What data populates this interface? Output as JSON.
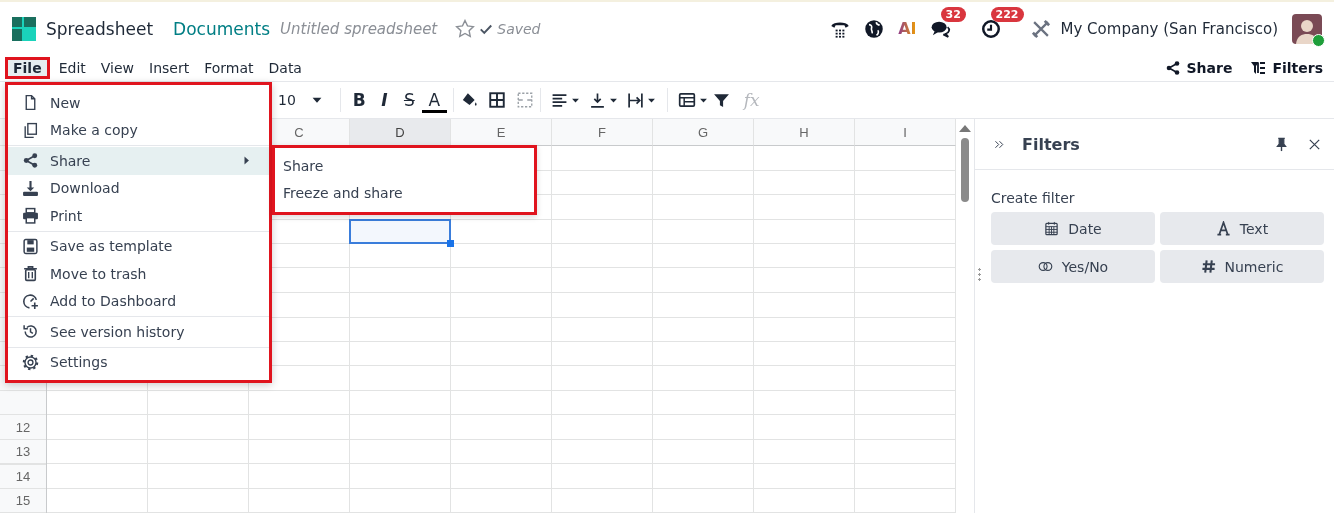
{
  "app": {
    "name": "Spreadsheet"
  },
  "breadcrumb": {
    "parent": "Documents",
    "title": "Untitled spreadsheet",
    "favorite": false,
    "status": "Saved"
  },
  "systray": [
    {
      "kind": "phone"
    },
    {
      "kind": "globe"
    },
    {
      "kind": "ai",
      "label": "AI"
    },
    {
      "kind": "chat",
      "badge": "32"
    },
    {
      "kind": "activity",
      "badge": "222"
    },
    {
      "kind": "tools"
    }
  ],
  "company": "My Company (San Francisco)",
  "user": {
    "online": true
  },
  "menubar": [
    {
      "label": "File",
      "selected": true
    },
    {
      "label": "Edit",
      "selected": false
    },
    {
      "label": "View",
      "selected": false
    },
    {
      "label": "Insert",
      "selected": false
    },
    {
      "label": "Format",
      "selected": false
    },
    {
      "label": "Data",
      "selected": false
    }
  ],
  "actions": [
    {
      "kind": "share",
      "label": "Share"
    },
    {
      "kind": "filters",
      "label": "Filters"
    }
  ],
  "toolbar": {
    "font_size": "10",
    "format": [
      {
        "kind": "bold",
        "label": "B"
      },
      {
        "kind": "italic",
        "label": "I"
      },
      {
        "kind": "strike",
        "label": "S"
      },
      {
        "kind": "color",
        "label": "A"
      }
    ],
    "formula_icon": "fx"
  },
  "grid": {
    "columns": [
      {
        "label": "C",
        "selected": false
      },
      {
        "label": "D",
        "selected": true
      },
      {
        "label": "E",
        "selected": false
      },
      {
        "label": "F",
        "selected": false
      },
      {
        "label": "G",
        "selected": false
      },
      {
        "label": "H",
        "selected": false
      },
      {
        "label": "I",
        "selected": false
      }
    ],
    "rows": [
      "12",
      "13",
      "14",
      "15"
    ]
  },
  "file_menu": [
    [
      {
        "kind": "new",
        "label": "New",
        "selected": false
      },
      {
        "kind": "copy",
        "label": "Make a copy",
        "selected": false
      }
    ],
    [
      {
        "kind": "share",
        "label": "Share",
        "selected": true,
        "submenu": true
      },
      {
        "kind": "download",
        "label": "Download",
        "selected": false
      },
      {
        "kind": "print",
        "label": "Print",
        "selected": false
      }
    ],
    [
      {
        "kind": "save",
        "label": "Save as template",
        "selected": false
      },
      {
        "kind": "trash",
        "label": "Move to trash",
        "selected": false
      },
      {
        "kind": "dashboard",
        "label": "Add to Dashboard",
        "selected": false
      }
    ],
    [
      {
        "kind": "history",
        "label": "See version history",
        "selected": false
      }
    ],
    [
      {
        "kind": "settings",
        "label": "Settings",
        "selected": false
      }
    ]
  ],
  "share_submenu": [
    "Share",
    "Freeze and share"
  ],
  "filters_panel": {
    "title": "Filters",
    "section": "Create filter",
    "types": [
      {
        "kind": "date",
        "label": "Date"
      },
      {
        "kind": "text",
        "label": "Text"
      },
      {
        "kind": "yesno",
        "label": "Yes/No"
      },
      {
        "kind": "numeric",
        "label": "Numeric"
      }
    ]
  }
}
